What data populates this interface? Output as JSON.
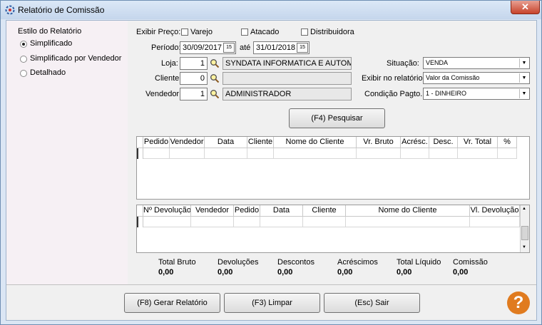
{
  "window": {
    "title": "Relatório de Comissão",
    "close": "✕"
  },
  "estilo": {
    "title": "Estilo do Relatório",
    "options": [
      "Simplificado",
      "Simplificado por Vendedor",
      "Detalhado"
    ],
    "selected": "Simplificado"
  },
  "exibir_preco": {
    "label": "Exibir Preço:",
    "options": [
      {
        "label": "Varejo",
        "checked": false
      },
      {
        "label": "Atacado",
        "checked": false
      },
      {
        "label": "Distribuidora",
        "checked": false
      }
    ]
  },
  "periodo": {
    "label": "Período:",
    "from": "30/09/2017",
    "ate": "até",
    "to": "31/01/2018",
    "cal_icon": "15"
  },
  "loja": {
    "label": "Loja:",
    "code": "1",
    "name": "SYNDATA INFORMATICA E AUTOMAC"
  },
  "cliente": {
    "label": "Cliente:",
    "code": "0",
    "name": ""
  },
  "vendedor": {
    "label": "Vendedor:",
    "code": "1",
    "name": "ADMINISTRADOR"
  },
  "situacao": {
    "label": "Situação:",
    "value": "VENDA"
  },
  "exibir_no_relatorio": {
    "label": "Exibir no relatório:",
    "value": "Valor da Comissão"
  },
  "condicao_pagto": {
    "label": "Condição Pagto.:",
    "value": "1 - DINHEIRO"
  },
  "pesquisar_button": {
    "label": "(F4) Pesquisar"
  },
  "vendas_grid": {
    "columns": [
      "Pedido",
      "Vendedor",
      "Data",
      "Cliente",
      "Nome do Cliente",
      "Vr. Bruto",
      "Acrésc.",
      "Desc.",
      "Vr. Total",
      "%"
    ]
  },
  "devolucao_grid": {
    "columns": [
      "Nº Devolução",
      "Vendedor",
      "Pedido",
      "Data",
      "Cliente",
      "Nome do Cliente",
      "Vl. Devolução"
    ]
  },
  "totais": [
    {
      "label": "Total Bruto",
      "value": "0,00"
    },
    {
      "label": "Devoluções",
      "value": "0,00"
    },
    {
      "label": "Descontos",
      "value": "0,00"
    },
    {
      "label": "Acréscimos",
      "value": "0,00"
    },
    {
      "label": "Total Líquido",
      "value": "0,00"
    },
    {
      "label": "Comissão",
      "value": "0,00"
    }
  ],
  "footer": {
    "gerar": "(F8) Gerar Relatório",
    "limpar": "(F3) Limpar",
    "sair": "(Esc) Sair",
    "help_icon": "?"
  },
  "colors": {
    "help": "#e07b1f",
    "accent": "#0b5394"
  }
}
